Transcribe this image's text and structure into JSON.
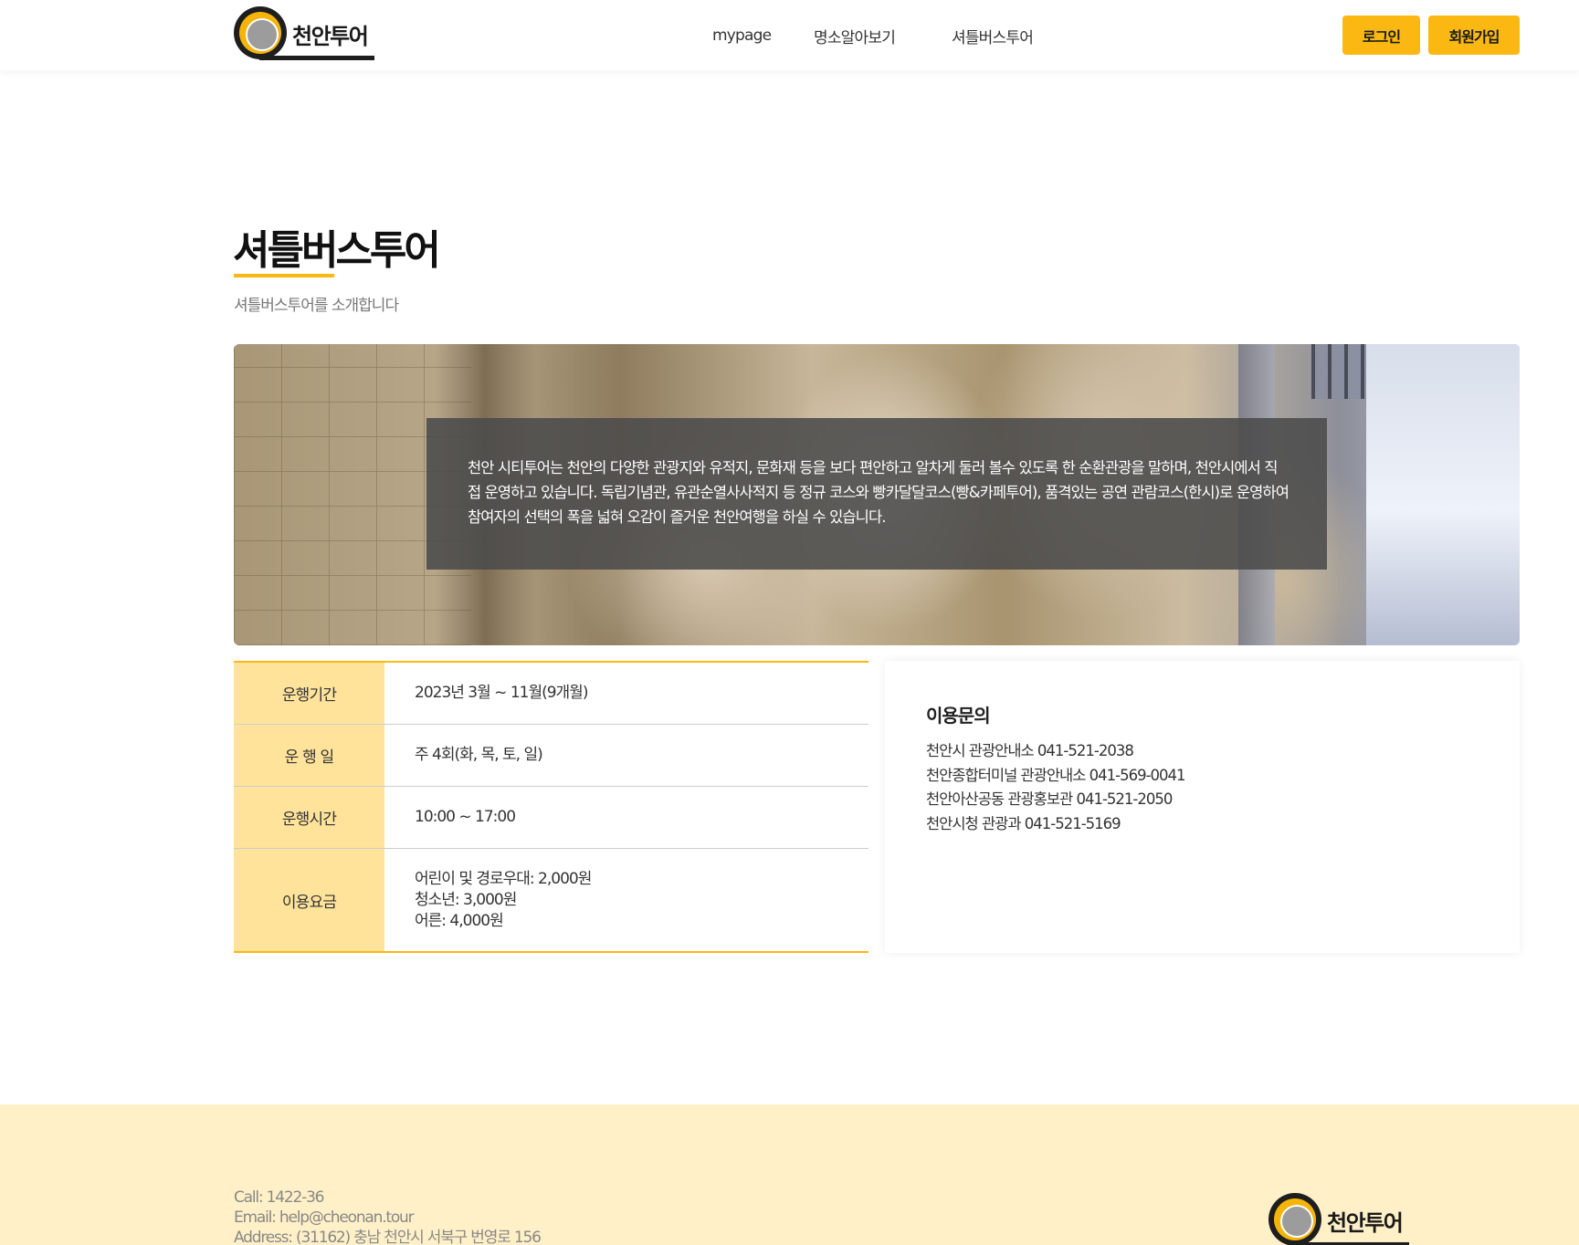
{
  "header": {
    "logo_text": "천안투어",
    "nav": [
      "mypage",
      "명소알아보기",
      "셔틀버스투어"
    ],
    "login_label": "로그인",
    "signup_label": "회원가입"
  },
  "page": {
    "title": "셔틀버스투어",
    "subtitle": "셔틀버스투어를 소개합니다",
    "banner_text": "천안 시티투어는 천안의 다양한 관광지와 유적지, 문화재 등을 보다 편안하고 알차게 둘러 볼수 있도록 한 순환관광을 말하며, 천안시에서 직접 운영하고 있습니다. 독립기념관, 유관순열사사적지 등 정규 코스와 빵카달달코스(빵&카페투어), 품격있는 공연 관람코스(한시)로 운영하여 참여자의 선택의 폭을 넓혀 오감이 즐거운 천안여행을 하실 수 있습니다."
  },
  "info": {
    "rows": [
      {
        "key": "운행기간",
        "values": [
          "2023년 3월 ~ 11월(9개월)"
        ]
      },
      {
        "key": "운 행 일",
        "values": [
          "주 4회(화, 목, 토, 일)"
        ]
      },
      {
        "key": "운행시간",
        "values": [
          "10:00 ~ 17:00"
        ]
      },
      {
        "key": "이용요금",
        "values": [
          "어린이 및 경로우대: 2,000원",
          "청소년: 3,000원",
          "어른: 4,000원"
        ]
      }
    ]
  },
  "contact": {
    "title": "이용문의",
    "lines": [
      "천안시 관광안내소 041-521-2038",
      "천안종합터미널 관광안내소 041-569-0041",
      "천안아산공동 관광홍보관 041-521-2050",
      "천안시청 관광과 041-521-5169"
    ]
  },
  "footer": {
    "call": "Call: 1422-36",
    "email": "Email: help@cheonan.tour",
    "address": "Address: (31162) 충남 천안시 서북구 번영로 156",
    "logo_text": "천안투어"
  },
  "colors": {
    "accent": "#fbb812",
    "table_key_bg": "#ffe39b",
    "footer_bg": "#fff0c7"
  }
}
